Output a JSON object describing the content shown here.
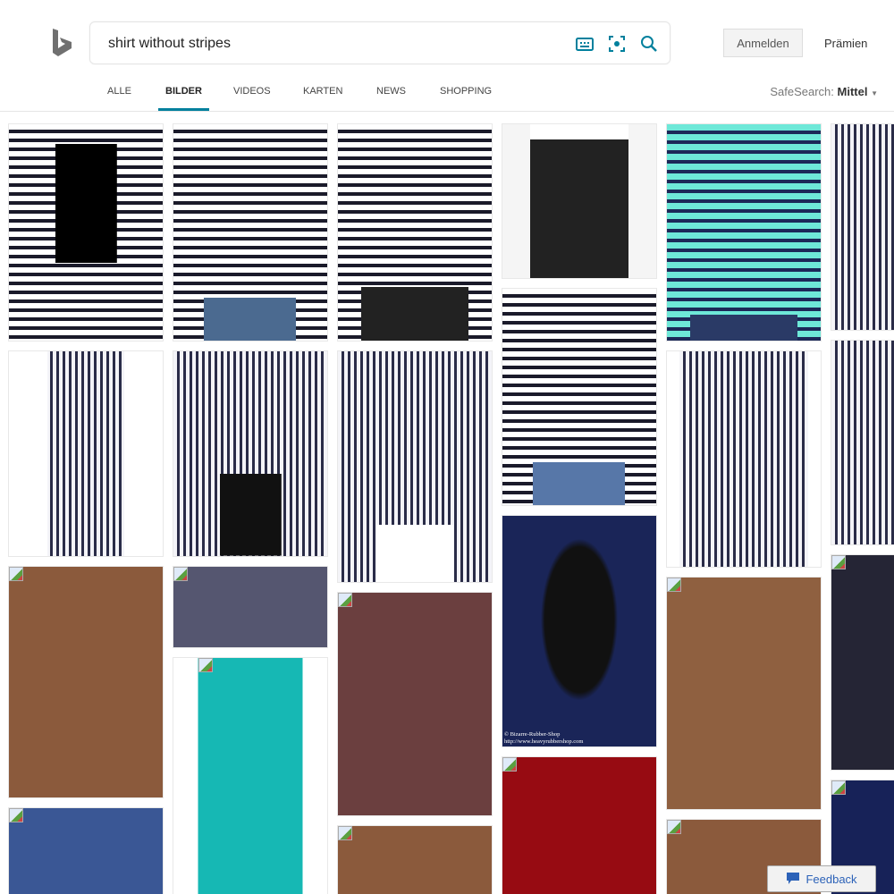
{
  "search": {
    "query": "shirt without stripes"
  },
  "header": {
    "signin_label": "Anmelden",
    "rewards_label": "Prämien"
  },
  "tabs": [
    "ALLE",
    "BILDER",
    "VIDEOS",
    "KARTEN",
    "NEWS",
    "SHOPPING"
  ],
  "active_tab": "BILDER",
  "safesearch": {
    "label": "SafeSearch:",
    "value": "Mittel"
  },
  "watermark": {
    "line1": "© Bizarre-Rubber-Shop",
    "line2": "http://www.heavyrubbershop.com"
  },
  "feedback_label": "Feedback",
  "colors": {
    "accent": "#00809d",
    "placeholders": [
      "#8b5a3c",
      "#3a5795",
      "#555670",
      "#16b8b4",
      "#6b3f3f",
      "#970b12",
      "#8f6040",
      "#252535",
      "#172258"
    ]
  }
}
